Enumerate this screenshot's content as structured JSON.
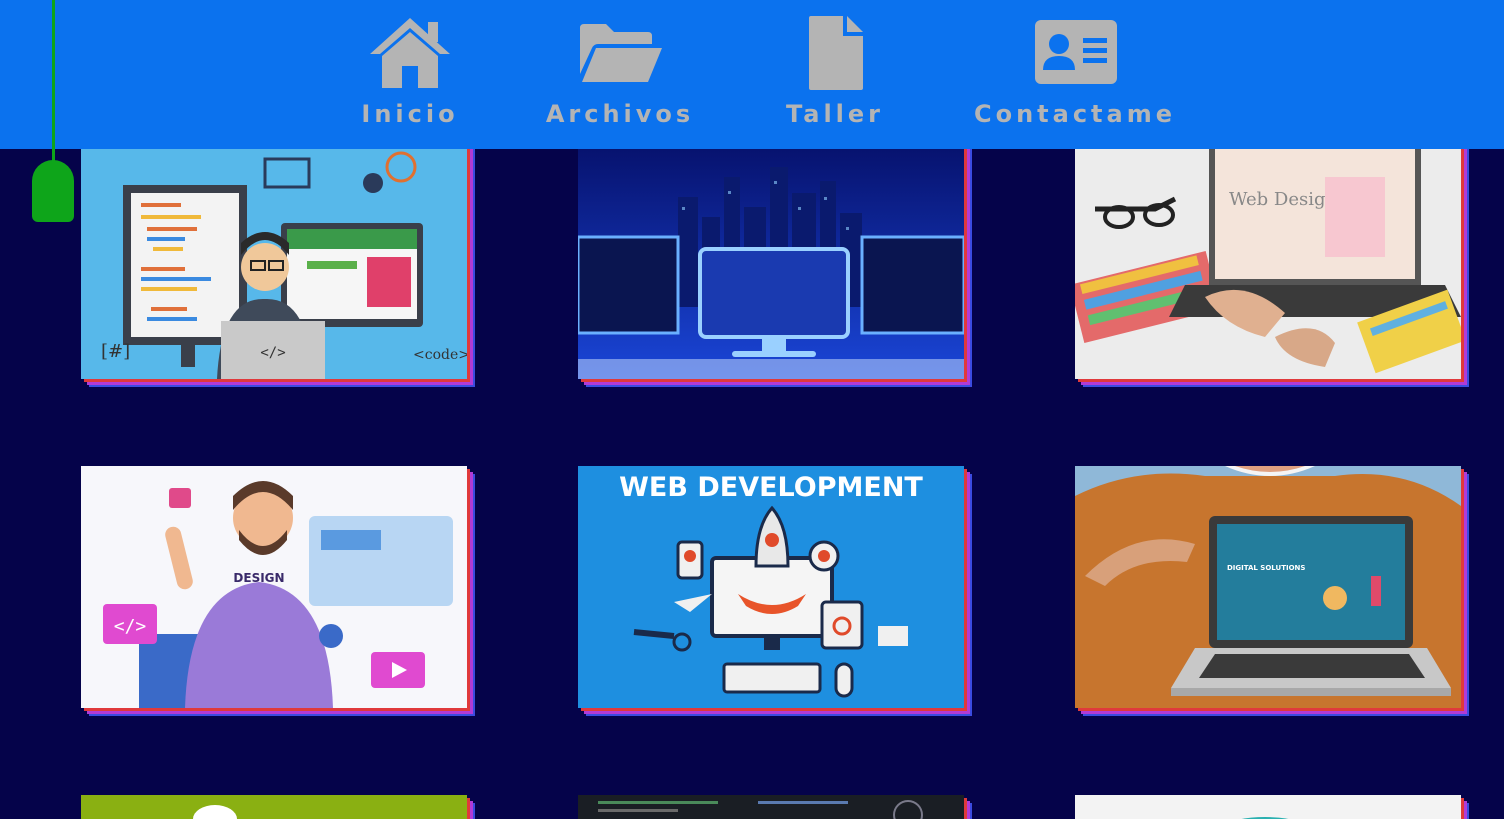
{
  "nav": {
    "items": [
      {
        "label": "Inicio",
        "icon": "home-icon"
      },
      {
        "label": "Archivos",
        "icon": "folder-open-icon"
      },
      {
        "label": "Taller",
        "icon": "file-icon"
      },
      {
        "label": "Contactame",
        "icon": "contact-card-icon"
      }
    ]
  },
  "gallery": {
    "card_web_development_title": "WEB DEVELOPMENT",
    "card_web_design_text": "Web Design",
    "card_digital_solutions_text": "DIGITAL SOLUTIONS",
    "card_design_shirt_text": "DESIGN",
    "card_code_tag": "</>",
    "card_code_label": "<code>",
    "card_hash_label": "[#]"
  },
  "colors": {
    "nav_background": "#0b72ee",
    "page_background": "#05034a",
    "nav_icon_and_text": "#b4b4b4",
    "scroll_handle": "#0ea51a"
  }
}
